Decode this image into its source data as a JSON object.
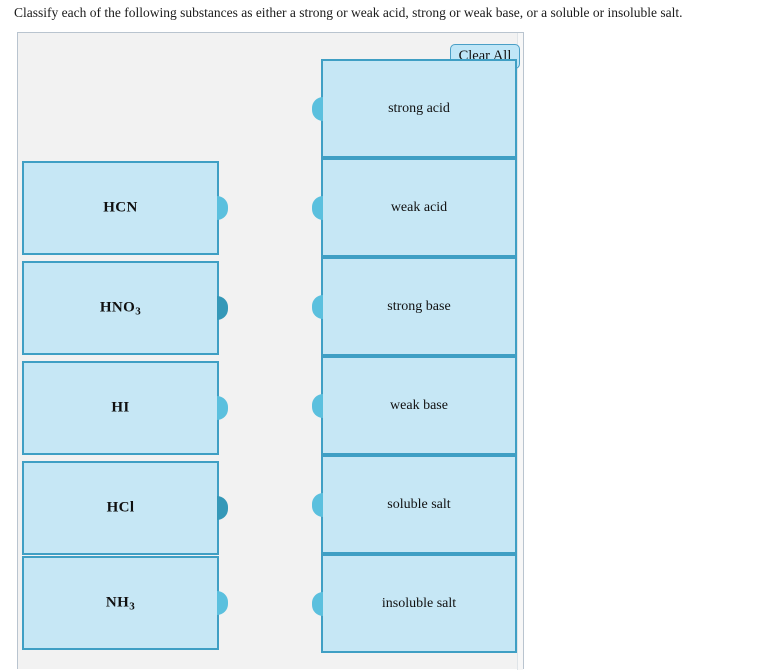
{
  "question": {
    "prompt": "Classify each of the following substances as either a strong or weak acid, strong or weak base, or a soluble or insoluble salt."
  },
  "toolbar": {
    "clear_all_label": "Clear All"
  },
  "colors": {
    "tile_fill": "#c6e7f5",
    "tile_border": "#3f9fc4",
    "nub": "#5bc0de",
    "nub_dark": "#3498b8",
    "panel_background": "#f2f2f2",
    "panel_border": "#b9c4cf",
    "button_fill": "#bfe6f7",
    "button_border": "#4a9fc6"
  },
  "substances": [
    {
      "formula": "HCN",
      "base": "HCN",
      "subscript": "",
      "nub_shade": "light"
    },
    {
      "formula": "HNO3",
      "base": "HNO",
      "subscript": "3",
      "nub_shade": "dark"
    },
    {
      "formula": "HI",
      "base": "HI",
      "subscript": "",
      "nub_shade": "light"
    },
    {
      "formula": "HCl",
      "base": "HCl",
      "subscript": "",
      "nub_shade": "dark"
    },
    {
      "formula": "NH3",
      "base": "NH",
      "subscript": "3",
      "nub_shade": "light"
    }
  ],
  "categories": [
    {
      "label": "strong acid"
    },
    {
      "label": "weak acid"
    },
    {
      "label": "strong base"
    },
    {
      "label": "weak base"
    },
    {
      "label": "soluble salt"
    },
    {
      "label": "insoluble salt"
    }
  ]
}
